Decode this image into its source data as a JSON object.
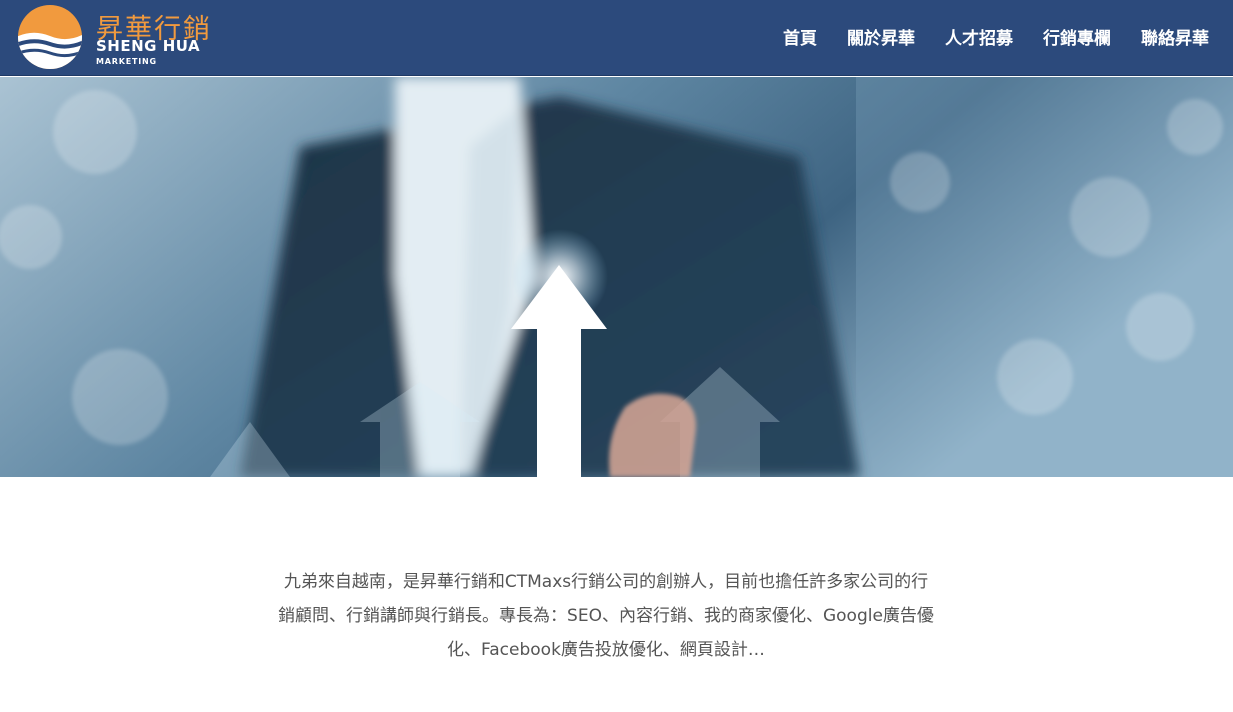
{
  "brand": {
    "name_cn": "昇華行銷",
    "name_en": "SHENG HUA",
    "tagline": "MARKETING",
    "colors": {
      "nav_bg": "#2c4a7c",
      "accent": "#f19a3e",
      "text": "#555555"
    }
  },
  "nav": {
    "items": [
      {
        "label": "首頁"
      },
      {
        "label": "關於昇華"
      },
      {
        "label": "人才招募"
      },
      {
        "label": "行銷專欄"
      },
      {
        "label": "聯絡昇華"
      }
    ]
  },
  "hero": {
    "image": "businessman-pointing-up-arrow-growth"
  },
  "intro": {
    "text": "九弟來自越南，是昇華行銷和CTMaxs行銷公司的創辦人，目前也擔任許多家公司的行銷顧問、行銷講師與行銷長。專長為：SEO、內容行銷、我的商家優化、Google廣告優化、Facebook廣告投放優化、網頁設計…"
  }
}
